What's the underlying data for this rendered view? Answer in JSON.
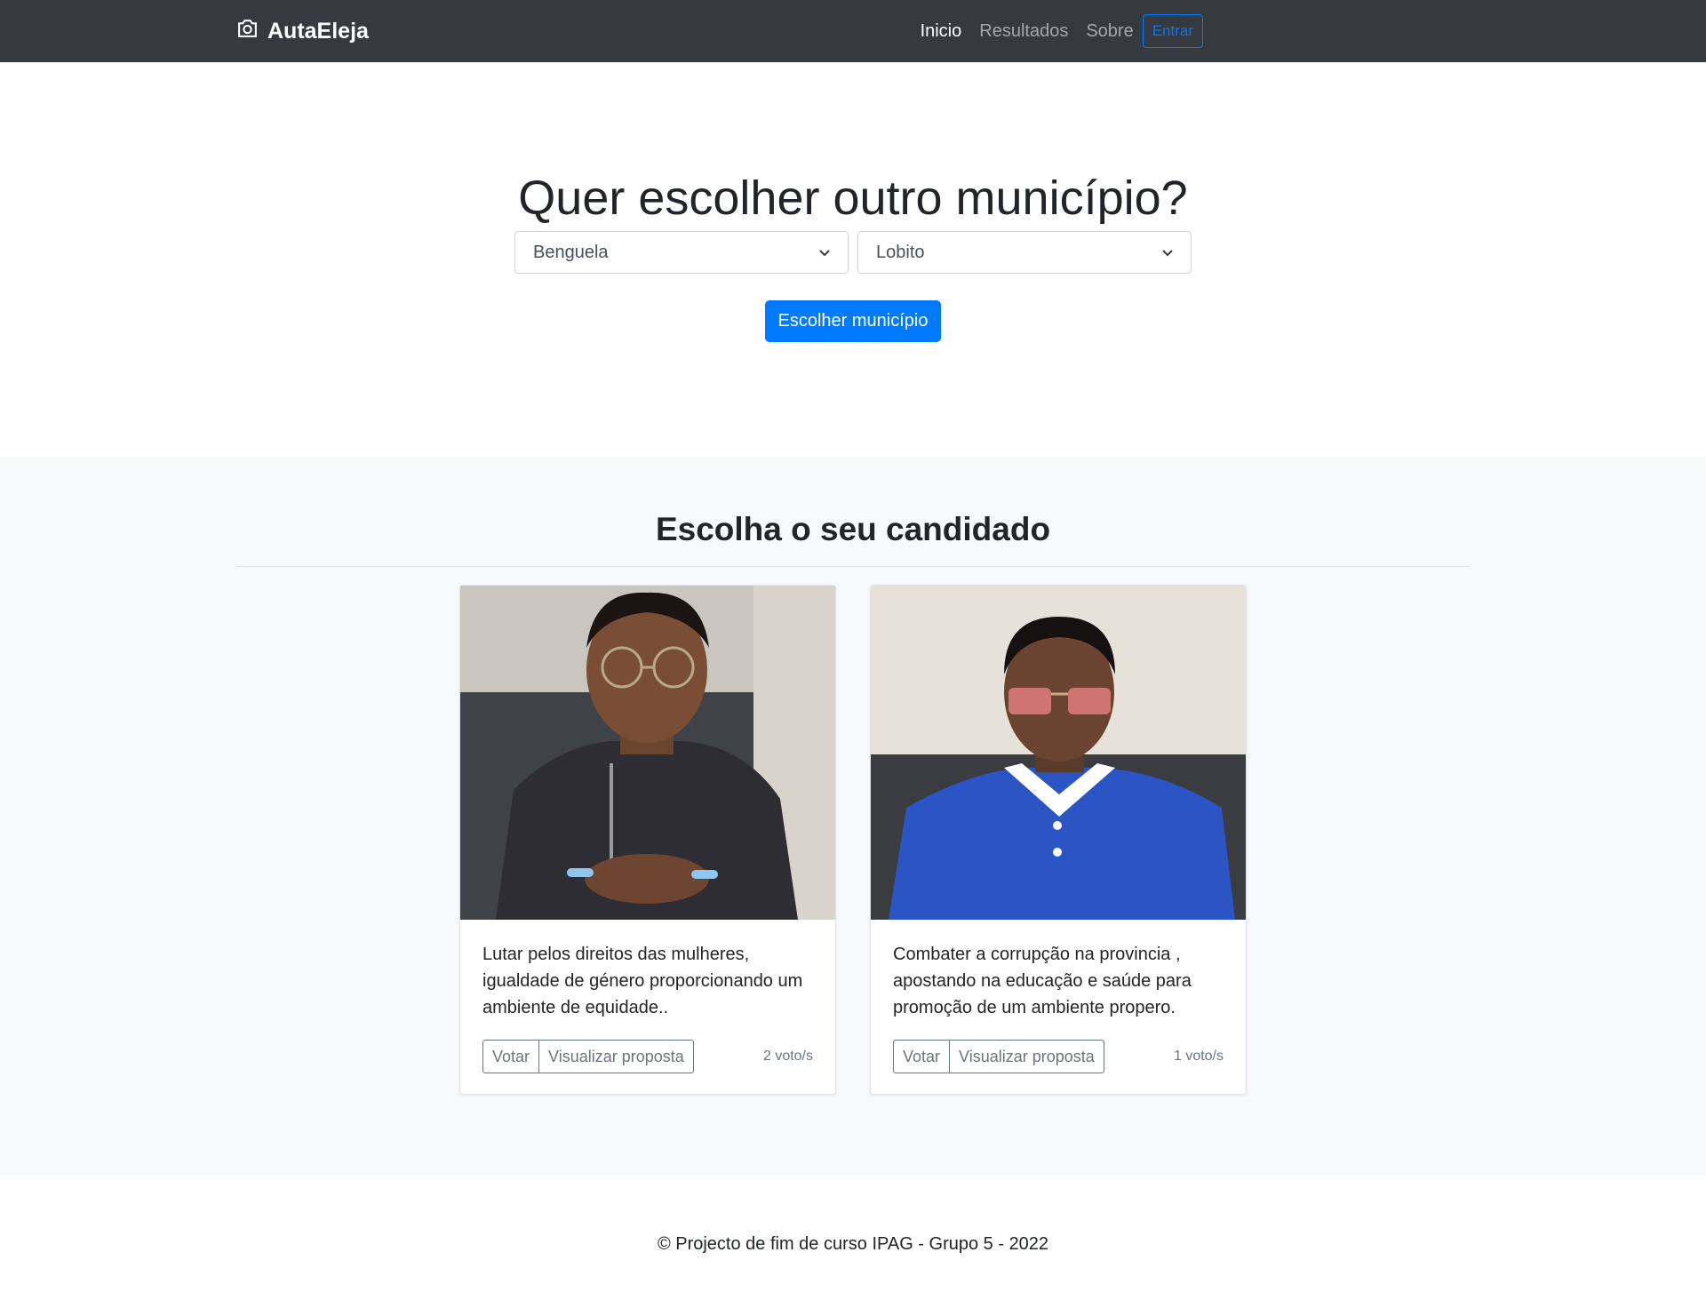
{
  "navbar": {
    "brand": "AutaEleja",
    "brand_icon": "camera-icon",
    "links": [
      "Inicio",
      "Resultados",
      "Sobre"
    ],
    "active": "Inicio",
    "login_label": "Entrar"
  },
  "hero": {
    "title": "Quer escolher outro município?",
    "province_value": "Benguela",
    "municipality_value": "Lobito",
    "submit_label": "Escolher município"
  },
  "candidates": {
    "title": "Escolha o seu candidado",
    "items": [
      {
        "description": "Lutar pelos direitos das mulheres, igualdade de género proporcionando um ambiente de equidade..",
        "vote_label": "Votar",
        "view_label": "Visualizar proposta",
        "votes": "2 voto/s"
      },
      {
        "description": "Combater a corrupção na provincia , apostando na educação e saúde para promoção de um ambiente propero.",
        "vote_label": "Votar",
        "view_label": "Visualizar proposta",
        "votes": "1 voto/s"
      }
    ]
  },
  "footer": {
    "text": "© Projecto de fim de curso IPAG - Grupo 5 - 2022"
  },
  "colors": {
    "navbar_bg": "#343a40",
    "primary": "#007bff",
    "section_bg": "#f8f9fa"
  }
}
